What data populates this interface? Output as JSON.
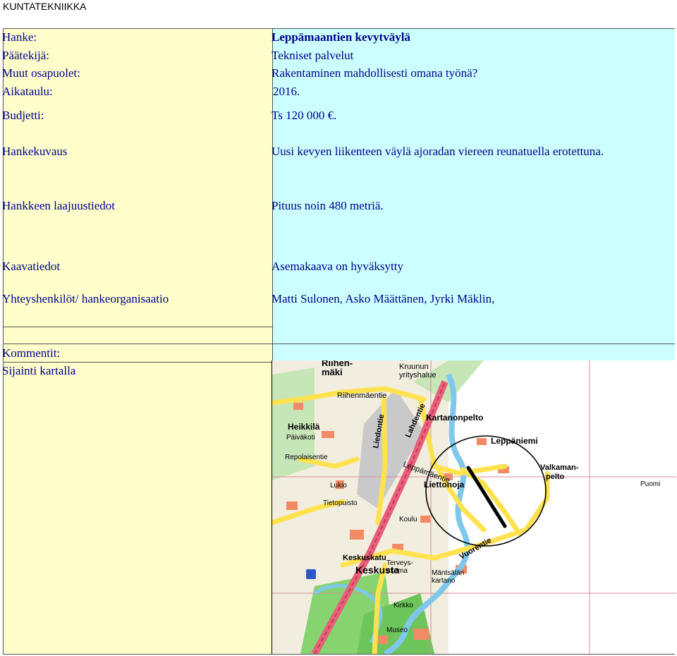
{
  "header": {
    "title": "KUNTATEKNIIKKA"
  },
  "rows": {
    "hanke": {
      "label": "Hanke:",
      "value": "Leppämaantien kevytväylä"
    },
    "paatekija": {
      "label": "Päätekijä:",
      "value": "Tekniset palvelut"
    },
    "muut": {
      "label": "Muut osapuolet:",
      "value": "Rakentaminen mahdollisesti omana työnä?"
    },
    "aikataulu": {
      "label": "Aikataulu:",
      "value": "2016."
    },
    "budjetti": {
      "label": "Budjetti:",
      "value": "Ts 120 000 €."
    },
    "kuvaus": {
      "label": "Hankekuvaus",
      "value": "Uusi kevyen liikenteen väylä ajoradan viereen reunatuella erotettuna."
    },
    "laajuus": {
      "label": "Hankkeen laajuustiedot",
      "value": "Pituus noin 480 metriä."
    },
    "kaava": {
      "label": "Kaavatiedot",
      "value": "Asemakaava on hyväksytty"
    },
    "yhteys": {
      "label": "Yhteyshenkilöt/ hankeorganisaatio",
      "value": "Matti Sulonen, Asko Määttänen, Jyrki Mäklin,"
    },
    "kommentit": {
      "label": "Kommentit:"
    },
    "sijainti": {
      "label": "Sijainti kartalla"
    }
  },
  "map": {
    "labels": {
      "riihenmaki": "Riihen-\nmäki",
      "kruunun": "Kruunun\nyrityshalue",
      "riihenmaentie": "Riihenmäentie",
      "heikkila": "Heikkilä",
      "kartanonpelto": "Kartanonpelto",
      "leppaniemi": "Leppäniemi",
      "valkamanpelto": "Valkaman-\npelto",
      "puomi": "Puomi",
      "liettonoja": "Liettonoja",
      "leppamaantie": "Leppämäentie",
      "keskusta": "Keskusta",
      "keskuskatu": "Keskuskatu",
      "lukio": "Lukio",
      "koulu": "Koulu",
      "tietopuisto": "Tietopuisto",
      "terveysasema": "Terveys-\nasema",
      "mantsalan": "Mäntsälän\nkartano",
      "vuoritie": "Vuorentie",
      "lahdentie": "Lahdentie",
      "liedontie": "Liedontie",
      "kirkko": "Kirkko",
      "museo": "Museo",
      "paivakoti": "Päiväkoti",
      "repola": "Repolaisentie"
    },
    "colors": {
      "road_yellow": "#ffe24d",
      "road_pink": "#e8607a",
      "water": "#7fc8ec",
      "park": "#7ccf68",
      "industrial": "#c8c8c8",
      "building": "#f28a66"
    }
  }
}
